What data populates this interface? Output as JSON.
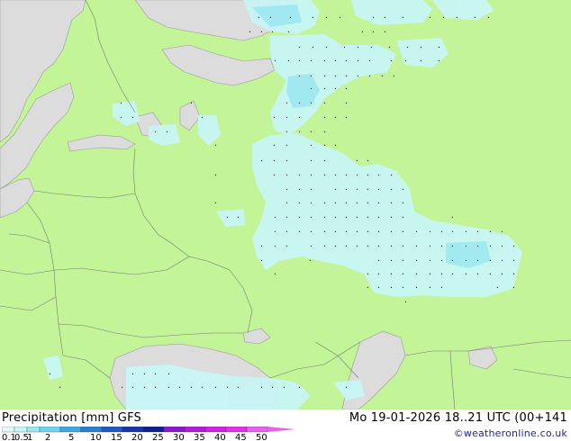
{
  "title": "Precipitation [mm] GFS",
  "timestamp": "Mo 19-01-2026 18..21 UTC (00+141",
  "credit": "©weatheronline.co.uk",
  "colors": {
    "sea": "#dcdcdc",
    "land": "#c3f598",
    "precip_light": "#c8f5f5",
    "precip_medium": "#9de8f0",
    "border": "#777777",
    "coast": "#999999"
  },
  "scale": {
    "labels": [
      "0.1",
      "0.5",
      "1",
      "2",
      "5",
      "10",
      "15",
      "20",
      "25",
      "30",
      "35",
      "40",
      "45",
      "50"
    ],
    "colors": [
      "#e6f7f7",
      "#c8f5f5",
      "#9de8f0",
      "#6fd2f0",
      "#3fa8e0",
      "#2d7fd0",
      "#2259c0",
      "#1836a8",
      "#101f90",
      "#8a1ac8",
      "#b01cd8",
      "#d020e0",
      "#e030e8",
      "#e860f0"
    ]
  }
}
